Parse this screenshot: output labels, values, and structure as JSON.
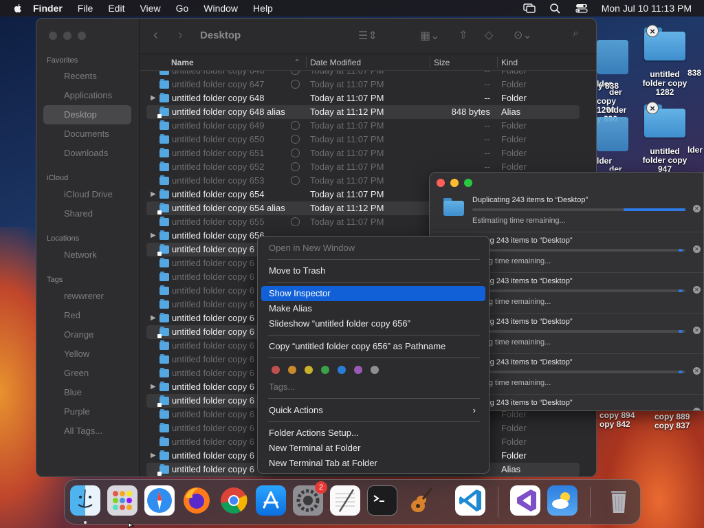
{
  "menubar": {
    "app_name": "Finder",
    "items": [
      "File",
      "Edit",
      "View",
      "Go",
      "Window",
      "Help"
    ],
    "clock": "Mon Jul 10  11:13 PM"
  },
  "desktop_icons": [
    {
      "label": "untitled folder copy 1282"
    },
    {
      "label": "untitled folder copy 947"
    }
  ],
  "desktop_partial_labels": [
    "lder",
    "der",
    "copy 1290",
    "older",
    "y 890",
    "y 838",
    "lder",
    "der",
    "copy 894",
    "opy 842",
    "copy 889",
    "copy 837",
    "838",
    "lder",
    "1258",
    "lder"
  ],
  "finder": {
    "title": "Desktop",
    "sidebar": {
      "favorites_header": "Favorites",
      "favorites": [
        "Recents",
        "Applications",
        "Desktop",
        "Documents",
        "Downloads"
      ],
      "selected": "Desktop",
      "icloud_header": "iCloud",
      "icloud": [
        "iCloud Drive",
        "Shared"
      ],
      "locations_header": "Locations",
      "locations": [
        "Network"
      ],
      "tags_header": "Tags",
      "tags": [
        "rewwrerer",
        "Red",
        "Orange",
        "Yellow",
        "Green",
        "Blue",
        "Purple",
        "All Tags..."
      ]
    },
    "columns": {
      "name": "Name",
      "date": "Date Modified",
      "size": "Size",
      "kind": "Kind"
    },
    "rows": [
      {
        "name": "untitled folder copy 646",
        "date": "Today at 11:07 PM",
        "size": "--",
        "kind": "Folder",
        "state": "dim",
        "pending": true
      },
      {
        "name": "untitled folder copy 647",
        "date": "Today at 11:07 PM",
        "size": "--",
        "kind": "Folder",
        "state": "dim",
        "pending": true
      },
      {
        "name": "untitled folder copy 648",
        "date": "Today at 11:07 PM",
        "size": "--",
        "kind": "Folder",
        "state": "bright",
        "disclosure": true
      },
      {
        "name": "untitled folder copy 648 alias",
        "date": "Today at 11:12 PM",
        "size": "848 bytes",
        "kind": "Alias",
        "state": "bright",
        "alias": true
      },
      {
        "name": "untitled folder copy 649",
        "date": "Today at 11:07 PM",
        "size": "--",
        "kind": "Folder",
        "state": "dim",
        "pending": true
      },
      {
        "name": "untitled folder copy 650",
        "date": "Today at 11:07 PM",
        "size": "--",
        "kind": "Folder",
        "state": "dim",
        "pending": true
      },
      {
        "name": "untitled folder copy 651",
        "date": "Today at 11:07 PM",
        "size": "--",
        "kind": "Folder",
        "state": "dim",
        "pending": true
      },
      {
        "name": "untitled folder copy 652",
        "date": "Today at 11:07 PM",
        "size": "--",
        "kind": "Folder",
        "state": "dim",
        "pending": true
      },
      {
        "name": "untitled folder copy 653",
        "date": "Today at 11:07 PM",
        "size": "--",
        "kind": "Folder",
        "state": "dim",
        "pending": true
      },
      {
        "name": "untitled folder copy 654",
        "date": "Today at 11:07 PM",
        "size": "--",
        "kind": "Folder",
        "state": "bright",
        "disclosure": true
      },
      {
        "name": "untitled folder copy 654 alias",
        "date": "Today at 11:12 PM",
        "size": "",
        "kind": "",
        "state": "bright",
        "alias": true
      },
      {
        "name": "untitled folder copy 655",
        "date": "Today at 11:07 PM",
        "size": "",
        "kind": "",
        "state": "dim",
        "pending": true
      },
      {
        "name": "untitled folder copy 656",
        "date": "",
        "size": "",
        "kind": "",
        "state": "bright",
        "disclosure": true
      },
      {
        "name": "untitled folder copy 6",
        "date": "",
        "size": "",
        "kind": "",
        "state": "bright",
        "alias": true
      },
      {
        "name": "untitled folder copy 6",
        "date": "",
        "size": "",
        "kind": "",
        "state": "dim"
      },
      {
        "name": "untitled folder copy 6",
        "date": "",
        "size": "",
        "kind": "",
        "state": "dim"
      },
      {
        "name": "untitled folder copy 6",
        "date": "",
        "size": "",
        "kind": "",
        "state": "dim"
      },
      {
        "name": "untitled folder copy 6",
        "date": "",
        "size": "",
        "kind": "",
        "state": "dim"
      },
      {
        "name": "untitled folder copy 6",
        "date": "",
        "size": "",
        "kind": "",
        "state": "bright",
        "disclosure": true
      },
      {
        "name": "untitled folder copy 6",
        "date": "",
        "size": "",
        "kind": "",
        "state": "bright",
        "alias": true
      },
      {
        "name": "untitled folder copy 6",
        "date": "",
        "size": "",
        "kind": "",
        "state": "dim"
      },
      {
        "name": "untitled folder copy 6",
        "date": "",
        "size": "",
        "kind": "",
        "state": "dim"
      },
      {
        "name": "untitled folder copy 6",
        "date": "",
        "size": "",
        "kind": "",
        "state": "dim"
      },
      {
        "name": "untitled folder copy 6",
        "date": "",
        "size": "",
        "kind": "",
        "state": "bright",
        "disclosure": true
      },
      {
        "name": "untitled folder copy 6",
        "date": "",
        "size": "",
        "kind": "",
        "state": "bright",
        "alias": true
      },
      {
        "name": "untitled folder copy 6",
        "date": "",
        "size": "",
        "kind": "Folder",
        "state": "dim"
      },
      {
        "name": "untitled folder copy 6",
        "date": "",
        "size": "",
        "kind": "Folder",
        "state": "dim"
      },
      {
        "name": "untitled folder copy 6",
        "date": "",
        "size": "",
        "kind": "Folder",
        "state": "dim"
      },
      {
        "name": "untitled folder copy 6",
        "date": "",
        "size": "",
        "kind": "Folder",
        "state": "bright",
        "disclosure": true
      },
      {
        "name": "untitled folder copy 6",
        "date": "",
        "size": "",
        "kind": "Alias",
        "state": "bright",
        "alias": true
      }
    ]
  },
  "progress": {
    "items": [
      {
        "title": "Duplicating 243 items to “Desktop”",
        "status": "Estimating time remaining...",
        "progress": 0.29
      },
      {
        "title": "icating 243 items to “Desktop”",
        "status": "nating time remaining...",
        "progress": 0.0
      },
      {
        "title": "icating 243 items to “Desktop”",
        "status": "nating time remaining...",
        "progress": 0.0
      },
      {
        "title": "icating 243 items to “Desktop”",
        "status": "nating time remaining...",
        "progress": 0.02
      },
      {
        "title": "icating 243 items to “Desktop”",
        "status": "nating time remaining...",
        "progress": 0.02
      },
      {
        "title": "icating 243 items to “Desktop”",
        "status": "",
        "progress": 0.3
      }
    ]
  },
  "context_menu": {
    "open_new_window": "Open in New Window",
    "move_to_trash": "Move to Trash",
    "show_inspector": "Show Inspector",
    "make_alias": "Make Alias",
    "slideshow": "Slideshow “untitled folder copy 656”",
    "copy_pathname": "Copy “untitled folder copy 656” as Pathname",
    "tag_colors": [
      "#c0504d",
      "#c98a2a",
      "#c9b12a",
      "#3aa04a",
      "#2a7bd6",
      "#9b59b6",
      "#8e8e90"
    ],
    "tags": "Tags...",
    "quick_actions": "Quick Actions",
    "folder_actions_setup": "Folder Actions Setup...",
    "new_terminal": "New Terminal at Folder",
    "new_terminal_tab": "New Terminal Tab at Folder"
  },
  "dock": {
    "apps": [
      "finder",
      "launchpad",
      "safari",
      "firefox",
      "chrome",
      "app-store",
      "system-settings",
      "textedit",
      "terminal",
      "garageband",
      "vscode",
      "visual-studio",
      "weather",
      "trash"
    ],
    "settings_badge": "2"
  }
}
